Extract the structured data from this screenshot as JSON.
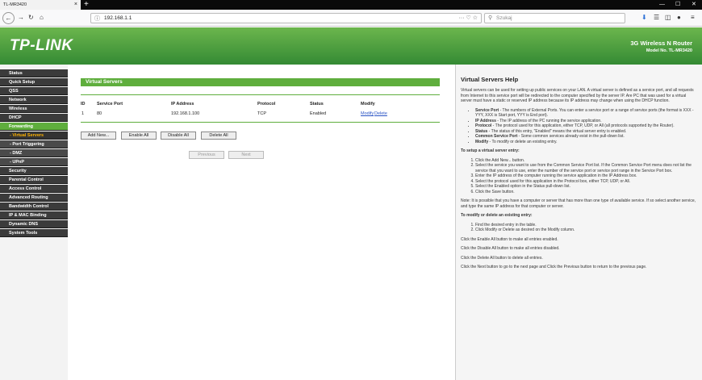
{
  "browser": {
    "tab_title": "TL-MR3420",
    "tab_close": "×",
    "new_tab": "+",
    "minimize": "—",
    "maximize": "☐",
    "close_window": "✕",
    "url": "192.168.1.1",
    "url_actions": "··· ♡ ☆",
    "search_placeholder": "Szukaj",
    "icons": [
      "back-icon",
      "forward-icon",
      "reload-icon",
      "home-icon",
      "info-icon",
      "download-icon",
      "library-icon",
      "sidebar-icon",
      "extension-icon",
      "menu-icon"
    ]
  },
  "header": {
    "logo": "TP-LINK",
    "product": "3G Wireless N Router",
    "model": "Model No. TL-MR3420"
  },
  "sidebar": {
    "items": [
      {
        "label": "Status"
      },
      {
        "label": "Quick Setup"
      },
      {
        "label": "QSS"
      },
      {
        "label": "Network"
      },
      {
        "label": "Wireless"
      },
      {
        "label": "DHCP"
      },
      {
        "label": "Forwarding"
      },
      {
        "label": "- Virtual Servers"
      },
      {
        "label": "- Port Triggering"
      },
      {
        "label": "- DMZ"
      },
      {
        "label": "- UPnP"
      },
      {
        "label": "Security"
      },
      {
        "label": "Parental Control"
      },
      {
        "label": "Access Control"
      },
      {
        "label": "Advanced Routing"
      },
      {
        "label": "Bandwidth Control"
      },
      {
        "label": "IP & MAC Binding"
      },
      {
        "label": "Dynamic DNS"
      },
      {
        "label": "System Tools"
      }
    ]
  },
  "main": {
    "title": "Virtual Servers",
    "columns": [
      "ID",
      "Service Port",
      "IP Address",
      "Protocol",
      "Status",
      "Modify"
    ],
    "rows": [
      {
        "id": "1",
        "port": "80",
        "ip": "192.168.1.100",
        "protocol": "TCP",
        "status": "Enabled",
        "modify": "Modify",
        "delete": "Delete"
      }
    ],
    "buttons": {
      "add_new": "Add New...",
      "enable_all": "Enable All",
      "disable_all": "Disable All",
      "delete_all": "Delete All",
      "previous": "Previous",
      "next": "Next"
    }
  },
  "help": {
    "title": "Virtual Servers Help",
    "intro": "Virtual servers can be used for setting up public services on your LAN. A virtual server is defined as a service port, and all requests from Internet to this service port will be redirected to the computer specified by the server IP. Are PC that was used for a virtual server must have a static or reserved IP address because its IP address may change when using the DHCP function.",
    "bullets": [
      {
        "term": "Service Port",
        "text": " - The numbers of External Ports. You can enter a service port or a range of service ports (the format is XXX - YYY, XXX is Start port, YYY is End port)."
      },
      {
        "term": "IP Address",
        "text": " - The IP address of the PC running the service application."
      },
      {
        "term": "Protocol",
        "text": " - The protocol used for this application, either TCP, UDP, or All (all protocols supported by the Router)."
      },
      {
        "term": "Status",
        "text": " - The status of this entry, \"Enabled\" means the virtual server entry is enabled."
      },
      {
        "term": "Common Service Port",
        "text": " - Some common services already exist in the pull-down list."
      },
      {
        "term": "Modify",
        "text": " - To modify or delete an existing entry."
      }
    ],
    "setup_heading": "To setup a virtual server entry:",
    "setup_steps": [
      "Click the Add New... button.",
      "Select the service you want to use from the Common Service Port list. If the Common Service Port menu does not list the service that you want to use, enter the number of the service port or service port range in the Service Port box.",
      "Enter the IP address of the computer running the service application in the IP Address box.",
      "Select the protocol used for this application in the Protocol box, either TCP, UDP, or All.",
      "Select the Enabled option in the Status pull-down list.",
      "Click the Save button."
    ],
    "note": "Note: It is possible that you have a computer or server that has more than one type of available service. If so select another service, and type the same IP address for that computer or server.",
    "modify_heading": "To modify or delete an existing entry:",
    "modify_steps": [
      "Find the desired entry in the table.",
      "Click Modify or Delete as desired on the Modify column."
    ],
    "enable_all_text": "Click the Enable All button to make all entries enabled.",
    "disable_all_text": "Click the Disable All button to make all entries disabled.",
    "delete_all_text": "Click the Delete All button to delete all entries.",
    "next_prev_text": "Click the Next button to go to the next page and Click the Previous button to return to the previous page."
  }
}
